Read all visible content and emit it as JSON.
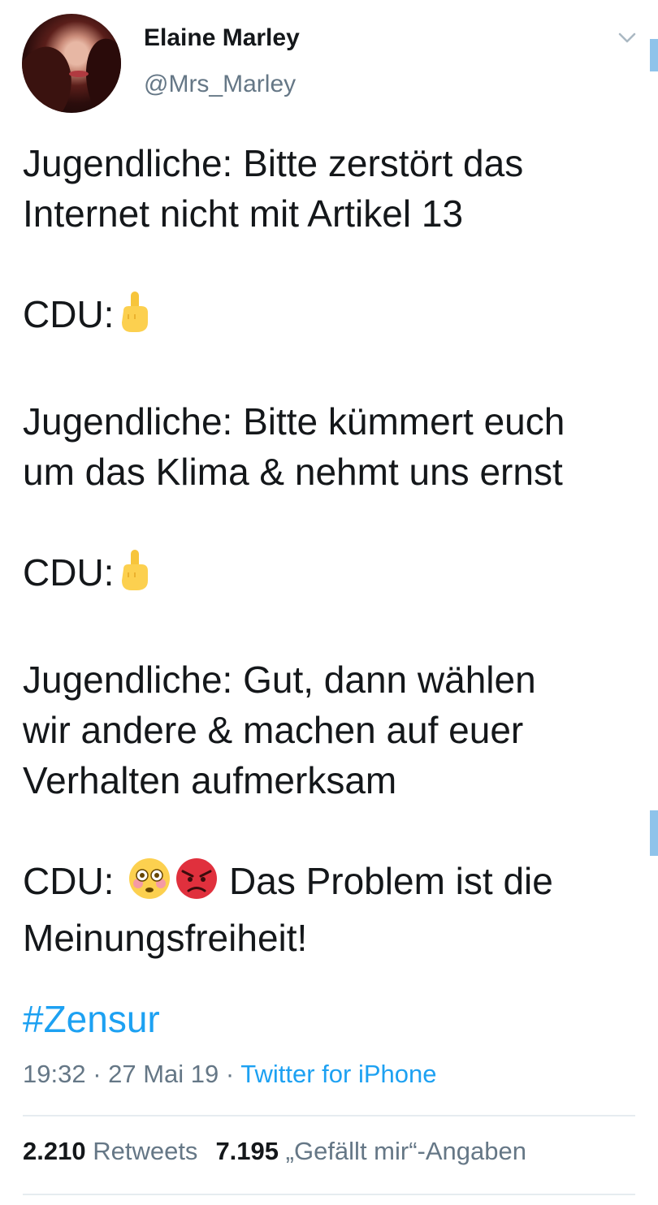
{
  "author": {
    "name": "Elaine Marley",
    "handle": "@Mrs_Marley"
  },
  "tweet": {
    "lines": [
      "Jugendliche: Bitte zerstört das",
      "Internet nicht mit Artikel 13",
      "CDU:",
      "Jugendliche: Bitte kümmert euch",
      "um das Klima & nehmt uns ernst",
      "CDU:",
      "Jugendliche: Gut, dann wählen",
      "wir andere & machen auf euer",
      "Verhalten aufmerksam",
      "CDU:",
      "Das Problem ist die",
      "Meinungsfreiheit!"
    ],
    "hashtag": "#Zensur"
  },
  "meta": {
    "time": "19:32",
    "separator": " · ",
    "date": "27 Mai 19",
    "source": "Twitter for iPhone"
  },
  "stats": {
    "retweets_count": "2.210",
    "retweets_label": "Retweets",
    "likes_count": "7.195",
    "likes_label": "„Gefällt mir“-Angaben"
  },
  "icons": {
    "middle_finger": "middle-finger-emoji",
    "flushed": "flushed-face-emoji",
    "angry": "angry-face-emoji",
    "chevron": "chevron-down-icon"
  },
  "colors": {
    "accent": "#1da1f2",
    "secondary_text": "#657786",
    "primary_text": "#14171a"
  }
}
